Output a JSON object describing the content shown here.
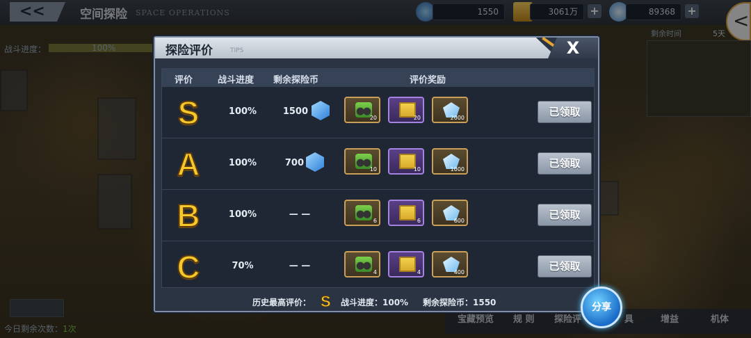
{
  "topbar": {
    "back_label": "<<",
    "title": "空间探险",
    "title_en": "SPACE OPERATIONS",
    "resources": [
      {
        "name": "explore-coin",
        "value": "1550"
      },
      {
        "name": "gold",
        "value": "3061万"
      },
      {
        "name": "diamond",
        "value": "89368"
      }
    ],
    "plus": "+"
  },
  "side": {
    "expand_glyph": "<"
  },
  "left_panel": {
    "progress_label": "战斗进度：",
    "progress_value": "100%",
    "progress_fraction": 1.0
  },
  "right_panel": {
    "time_label": "剩余时间",
    "time_value": "5天"
  },
  "bottom": {
    "today_label": "今日剩余次数：",
    "today_value": "1次",
    "nav": [
      "宝藏预览",
      "规 则",
      "探险评",
      "具",
      "增益",
      "机体"
    ]
  },
  "modal": {
    "title": "探险评价",
    "tips": "TIPS",
    "close": "X",
    "headers": [
      "评价",
      "战斗进度",
      "剩余探险币",
      "评价奖励"
    ],
    "rows": [
      {
        "grade": "S",
        "progress": "100%",
        "coins": "1500",
        "rewards": [
          "20",
          "20",
          "2000"
        ],
        "button": "已领取"
      },
      {
        "grade": "A",
        "progress": "100%",
        "coins": "700",
        "rewards": [
          "10",
          "10",
          "1000"
        ],
        "button": "已领取"
      },
      {
        "grade": "B",
        "progress": "100%",
        "coins": "— —",
        "rewards": [
          "6",
          "6",
          "600"
        ],
        "button": "已领取"
      },
      {
        "grade": "C",
        "progress": "70%",
        "coins": "— —",
        "rewards": [
          "4",
          "4",
          "400"
        ],
        "button": "已领取"
      }
    ],
    "footer": {
      "best_label": "历史最高评价：",
      "best_grade": "S",
      "progress_text": "战斗进度：100%",
      "coins_text": "剩余探险币：1550"
    }
  },
  "share": {
    "label": "分享"
  },
  "colors": {
    "grade": "#f6c829",
    "panel": "#2b3443",
    "claimed": "#8a96a6"
  }
}
